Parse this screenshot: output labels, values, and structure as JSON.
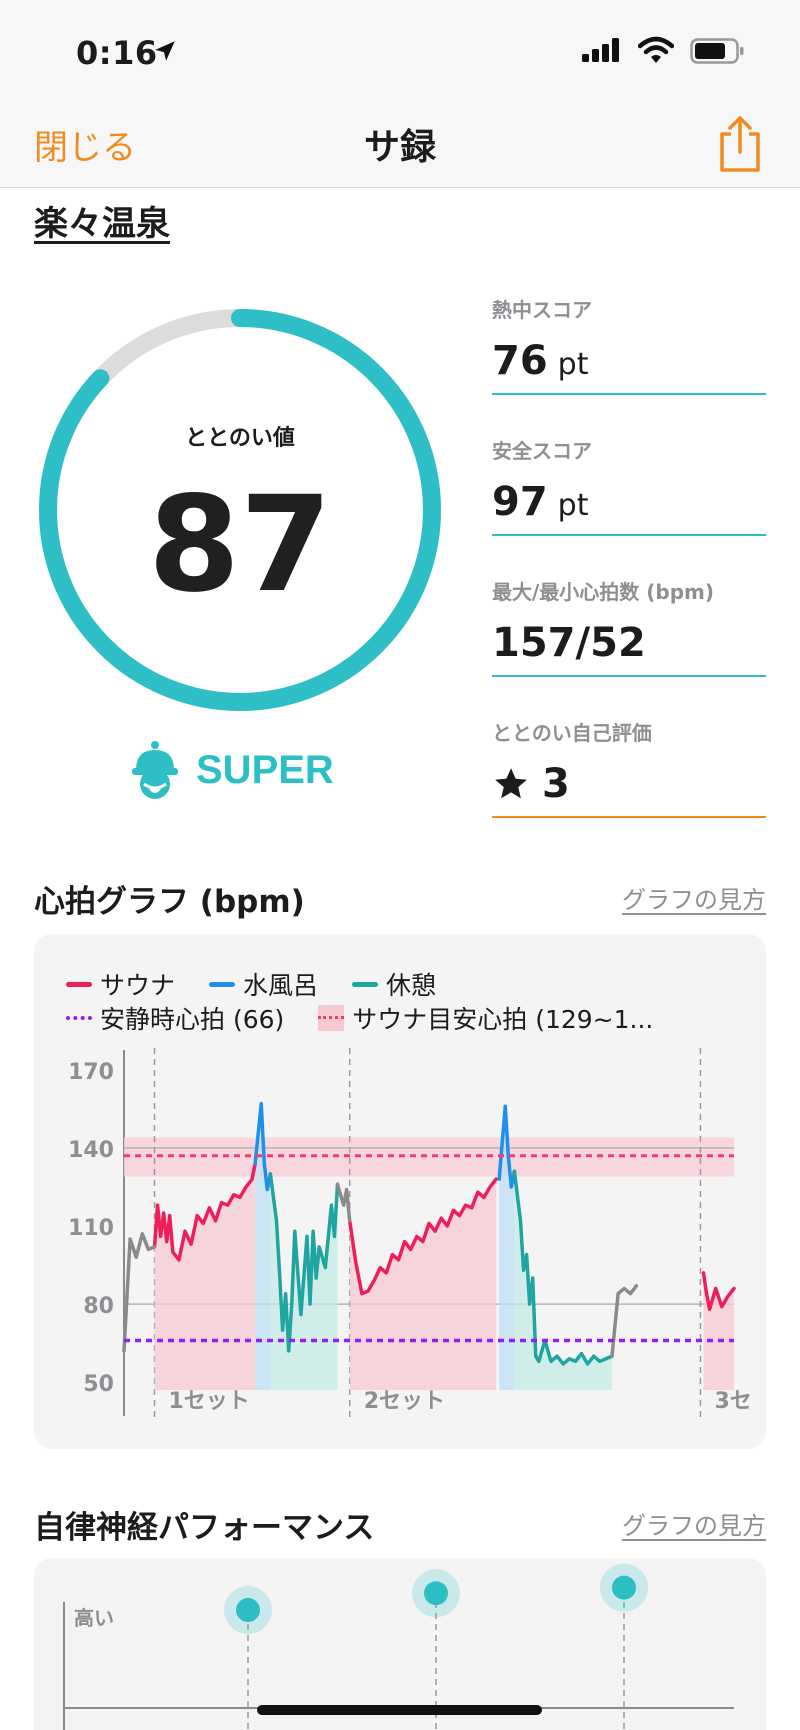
{
  "status_bar": {
    "time": "0:16"
  },
  "nav": {
    "close_label": "閉じる",
    "title": "サ録"
  },
  "place_name": "楽々温泉",
  "gauge": {
    "label": "ととのい値",
    "value": "87",
    "progress": 0.87,
    "rank": "SUPER"
  },
  "metrics": [
    {
      "label": "熱中スコア",
      "value": "76",
      "unit": "pt"
    },
    {
      "label": "安全スコア",
      "value": "97",
      "unit": "pt"
    },
    {
      "label": "最大/最小心拍数 (bpm)",
      "value": "157/52",
      "unit": ""
    },
    {
      "label": "ととのい自己評価",
      "value": "3",
      "unit": ""
    }
  ],
  "heart_section": {
    "title": "心拍グラフ (bpm)",
    "link": "グラフの見方"
  },
  "legend": {
    "sauna": "サウナ",
    "water": "水風呂",
    "rest": "休憩",
    "resting_hr": "安静時心拍 (66)",
    "sauna_target": "サウナ目安心拍 (129~1..."
  },
  "colors": {
    "accent": "#2dbfc5",
    "orange": "#f28b1d",
    "sauna": "#ee1f58",
    "water": "#1e8fea",
    "rest": "#1fa5a0",
    "resting": "#8f1ff2"
  },
  "chart_data": {
    "type": "line",
    "ylabel": "",
    "ylim": [
      47,
      173
    ],
    "yticks": [
      "170",
      "140",
      "110",
      "80",
      "50"
    ],
    "xlabels": [
      "1セット",
      "2セット",
      "3セ"
    ],
    "resting_hr": 66,
    "sauna_target_range": [
      129,
      144
    ],
    "sauna_target_line": 137,
    "set_boundaries": [
      0.05,
      0.37,
      0.945
    ],
    "series": [
      {
        "name": "サウナ",
        "segments": [
          [
            [
              0.05,
              102
            ],
            [
              0.055,
              118
            ],
            [
              0.06,
              106
            ],
            [
              0.065,
              115
            ],
            [
              0.07,
              104
            ],
            [
              0.075,
              114
            ],
            [
              0.08,
              100
            ],
            [
              0.09,
              97
            ],
            [
              0.1,
              108
            ],
            [
              0.11,
              103
            ],
            [
              0.12,
              114
            ],
            [
              0.13,
              111
            ],
            [
              0.14,
              117
            ],
            [
              0.15,
              112
            ],
            [
              0.16,
              119
            ],
            [
              0.17,
              118
            ],
            [
              0.18,
              122
            ],
            [
              0.19,
              121
            ],
            [
              0.2,
              125
            ],
            [
              0.21,
              128
            ],
            [
              0.215,
              134
            ]
          ],
          [
            [
              0.37,
              112
            ],
            [
              0.38,
              96
            ],
            [
              0.39,
              84
            ],
            [
              0.4,
              85
            ],
            [
              0.41,
              89
            ],
            [
              0.42,
              94
            ],
            [
              0.43,
              92
            ],
            [
              0.44,
              99
            ],
            [
              0.45,
              97
            ],
            [
              0.46,
              104
            ],
            [
              0.47,
              101
            ],
            [
              0.48,
              106
            ],
            [
              0.49,
              104
            ],
            [
              0.5,
              111
            ],
            [
              0.51,
              108
            ],
            [
              0.52,
              113
            ],
            [
              0.53,
              110
            ],
            [
              0.54,
              116
            ],
            [
              0.55,
              114
            ],
            [
              0.56,
              118
            ],
            [
              0.57,
              117
            ],
            [
              0.58,
              123
            ],
            [
              0.59,
              121
            ],
            [
              0.6,
              125
            ],
            [
              0.61,
              128
            ]
          ],
          [
            [
              0.95,
              92
            ],
            [
              0.955,
              84
            ],
            [
              0.96,
              78
            ],
            [
              0.97,
              86
            ],
            [
              0.98,
              79
            ],
            [
              0.99,
              83
            ],
            [
              1.0,
              86
            ]
          ]
        ]
      },
      {
        "name": "水風呂",
        "segments": [
          [
            [
              0.215,
              134
            ],
            [
              0.225,
              157
            ],
            [
              0.23,
              134
            ],
            [
              0.235,
              124
            ],
            [
              0.24,
              130
            ]
          ],
          [
            [
              0.615,
              128
            ],
            [
              0.625,
              156
            ],
            [
              0.63,
              137
            ],
            [
              0.635,
              125
            ],
            [
              0.64,
              131
            ]
          ]
        ]
      },
      {
        "name": "休憩",
        "segments": [
          [
            [
              0.24,
              130
            ],
            [
              0.25,
              112
            ],
            [
              0.255,
              92
            ],
            [
              0.26,
              70
            ],
            [
              0.265,
              84
            ],
            [
              0.27,
              62
            ],
            [
              0.275,
              80
            ],
            [
              0.28,
              108
            ],
            [
              0.29,
              76
            ],
            [
              0.3,
              106
            ],
            [
              0.305,
              80
            ],
            [
              0.31,
              108
            ],
            [
              0.315,
              90
            ],
            [
              0.32,
              102
            ],
            [
              0.33,
              94
            ],
            [
              0.34,
              118
            ],
            [
              0.345,
              106
            ],
            [
              0.35,
              126
            ]
          ],
          [
            [
              0.64,
              131
            ],
            [
              0.65,
              112
            ],
            [
              0.655,
              93
            ],
            [
              0.66,
              99
            ],
            [
              0.665,
              80
            ],
            [
              0.67,
              90
            ],
            [
              0.675,
              60
            ],
            [
              0.68,
              58
            ],
            [
              0.69,
              66
            ],
            [
              0.7,
              58
            ],
            [
              0.71,
              60
            ],
            [
              0.72,
              57
            ],
            [
              0.73,
              59
            ],
            [
              0.74,
              58
            ],
            [
              0.75,
              61
            ],
            [
              0.76,
              57
            ],
            [
              0.77,
              60
            ],
            [
              0.78,
              58
            ],
            [
              0.79,
              59
            ],
            [
              0.8,
              60
            ]
          ]
        ]
      },
      {
        "name": "other",
        "segments": [
          [
            [
              0.0,
              62
            ],
            [
              0.01,
              105
            ],
            [
              0.02,
              98
            ],
            [
              0.03,
              107
            ],
            [
              0.04,
              101
            ],
            [
              0.05,
              102
            ]
          ],
          [
            [
              0.35,
              126
            ],
            [
              0.355,
              122
            ],
            [
              0.36,
              118
            ],
            [
              0.365,
              124
            ],
            [
              0.37,
              112
            ]
          ],
          [
            [
              0.8,
              60
            ],
            [
              0.81,
              84
            ],
            [
              0.82,
              86
            ],
            [
              0.83,
              84
            ],
            [
              0.84,
              87
            ]
          ]
        ]
      }
    ]
  },
  "ans_section": {
    "title": "自律神経パフォーマンス",
    "link": "グラフの見方",
    "y_high_label": "高い",
    "points": [
      0.7,
      0.82,
      0.86
    ]
  }
}
